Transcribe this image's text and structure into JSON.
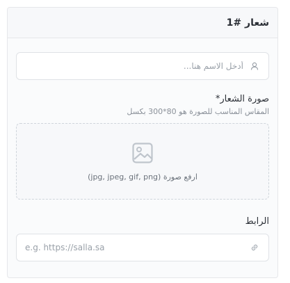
{
  "card": {
    "title": "شعار #1"
  },
  "name_field": {
    "placeholder": "أدخل الاسم هنا...",
    "value": ""
  },
  "logo": {
    "label": "صورة الشعار*",
    "hint": "المقاس المناسب للصورة هو 80*300 بكسل",
    "upload_text": "ارفع صورة (jpg, jpeg, gif, png)"
  },
  "url": {
    "label": "الرابط",
    "placeholder": "e.g. https://salla.sa",
    "value": ""
  },
  "icons": {
    "name_field_icon": "person-icon",
    "upload_icon": "image-icon",
    "url_field_icon": "link-icon"
  },
  "colors": {
    "border": "#dfe2e6",
    "muted_text": "#9aa1a9",
    "card_bg": "#fafbfc"
  }
}
